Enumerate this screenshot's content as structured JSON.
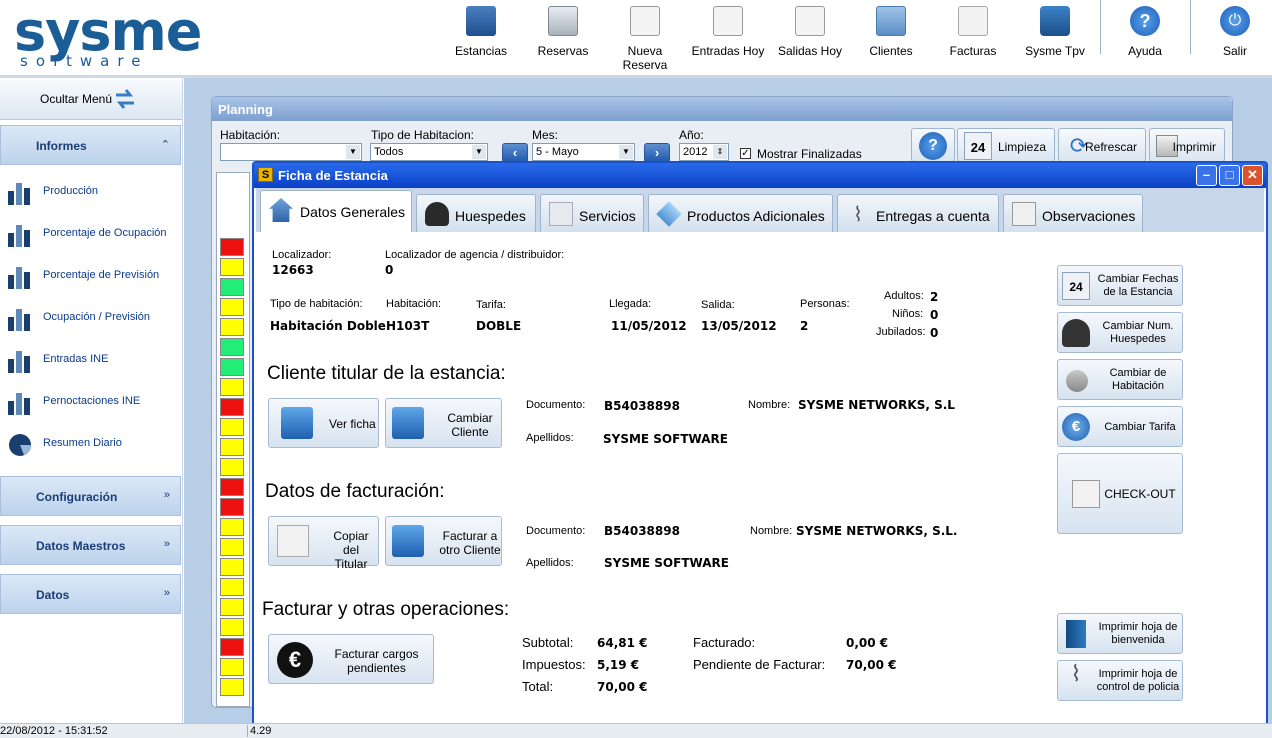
{
  "logo": {
    "main": "sysme",
    "sub": "software"
  },
  "toolbar": [
    {
      "label": "Estancias",
      "icon": "folder-user-icon"
    },
    {
      "label": "Reservas",
      "icon": "cabinet-icon"
    },
    {
      "label": "Nueva Reserva",
      "icon": "new-document-icon"
    },
    {
      "label": "Entradas Hoy",
      "icon": "arrow-in-icon"
    },
    {
      "label": "Salidas Hoy",
      "icon": "arrow-out-icon"
    },
    {
      "label": "Clientes",
      "icon": "address-book-icon"
    },
    {
      "label": "Facturas",
      "icon": "invoice-icon"
    },
    {
      "label": "Sysme Tpv",
      "icon": "cart-icon"
    },
    {
      "label": "Ayuda",
      "icon": "help-icon"
    },
    {
      "label": "Salir",
      "icon": "power-icon"
    }
  ],
  "leftmenu": {
    "hide_label": "Ocultar Menú",
    "informes": "Informes",
    "items": [
      "Producción",
      "Porcentaje de Ocupación",
      "Porcentaje de Previsión",
      "Ocupación / Previsión",
      "Entradas INE",
      "Pernoctaciones INE",
      "Resumen Diario"
    ],
    "configuracion": "Configuración",
    "datos_maestros": "Datos Maestros",
    "datos": "Datos"
  },
  "status": {
    "datetime": "22/08/2012 - 15:31:52",
    "extra": "4.29"
  },
  "planning": {
    "title": "Planning",
    "habitacion_label": "Habitación:",
    "habitacion_value": "",
    "tipo_label": "Tipo de Habitacion:",
    "tipo_value": "Todos",
    "mes_label": "Mes:",
    "mes_value": "5 - Mayo",
    "anio_label": "Año:",
    "anio_value": "2012",
    "mostrar_label": "Mostrar Finalizadas",
    "limpieza": "Limpieza",
    "refrescar": "Refrescar",
    "imprimir": "Imprimir",
    "cells": [
      "red",
      "yellow",
      "green",
      "yellow",
      "yellow",
      "green",
      "green",
      "yellow",
      "red",
      "yellow",
      "yellow",
      "yellow",
      "red",
      "red",
      "yellow",
      "yellow",
      "yellow",
      "yellow",
      "yellow",
      "yellow",
      "red",
      "yellow",
      "yellow"
    ],
    "colors": {
      "red": "#ee1111",
      "yellow": "#ffff00",
      "green": "#22ee77"
    }
  },
  "dialog": {
    "title": "Ficha de Estancia",
    "tabs": [
      "Datos Generales",
      "Huespedes",
      "Servicios",
      "Productos Adicionales",
      "Entregas a cuenta",
      "Observaciones"
    ],
    "localizador_label": "Localizador:",
    "localizador": "12663",
    "loc_agencia_label": "Localizador de agencia / distribuidor:",
    "loc_agencia": "0",
    "tipo_hab_label": "Tipo de habitación:",
    "tipo_hab": "Habitación Doble",
    "habitacion_label": "Habitación:",
    "habitacion": "H103T",
    "tarifa_label": "Tarifa:",
    "tarifa": "DOBLE",
    "llegada_label": "Llegada:",
    "llegada": "11/05/2012",
    "salida_label": "Salida:",
    "salida": "13/05/2012",
    "personas_label": "Personas:",
    "personas": "2",
    "adultos_label": "Adultos:",
    "adultos": "2",
    "ninos_label": "Niños:",
    "ninos": "0",
    "jubilados_label": "Jubilados:",
    "jubilados": "0",
    "cliente_heading": "Cliente titular de la estancia:",
    "ver_ficha": "Ver ficha",
    "cambiar_cliente": "Cambiar Cliente",
    "documento_label": "Documento:",
    "cliente_documento": "B54038898",
    "nombre_label": "Nombre:",
    "cliente_nombre": "SYSME NETWORKS, S.L",
    "apellidos_label": "Apellidos:",
    "cliente_apellidos": "SYSME SOFTWARE",
    "facturacion_heading": "Datos de facturación:",
    "copiar_titular": "Copiar del Titular",
    "facturar_otro": "Facturar a otro Cliente",
    "fact_documento": "B54038898",
    "fact_nombre": "SYSME NETWORKS, S.L.",
    "fact_apellidos": "SYSME SOFTWARE",
    "operaciones_heading": "Facturar y otras operaciones:",
    "facturar_cargos": "Facturar cargos pendientes",
    "subtotal_label": "Subtotal:",
    "subtotal": "64,81 €",
    "impuestos_label": "Impuestos:",
    "impuestos": "5,19 €",
    "total_label": "Total:",
    "total": "70,00 €",
    "facturado_label": "Facturado:",
    "facturado": "0,00 €",
    "pendiente_label": "Pendiente de Facturar:",
    "pendiente": "70,00 €",
    "right_buttons": {
      "cambiar_fechas": "Cambiar Fechas de la Estancia",
      "cambiar_huespedes": "Cambiar Num. Huespedes",
      "cambiar_habitacion": "Cambiar de Habitación",
      "cambiar_tarifa": "Cambiar Tarifa",
      "checkout": "CHECK-OUT",
      "hoja_bienvenida": "Imprimir hoja de bienvenida",
      "hoja_policia": "Imprimir hoja de control de policia"
    }
  }
}
